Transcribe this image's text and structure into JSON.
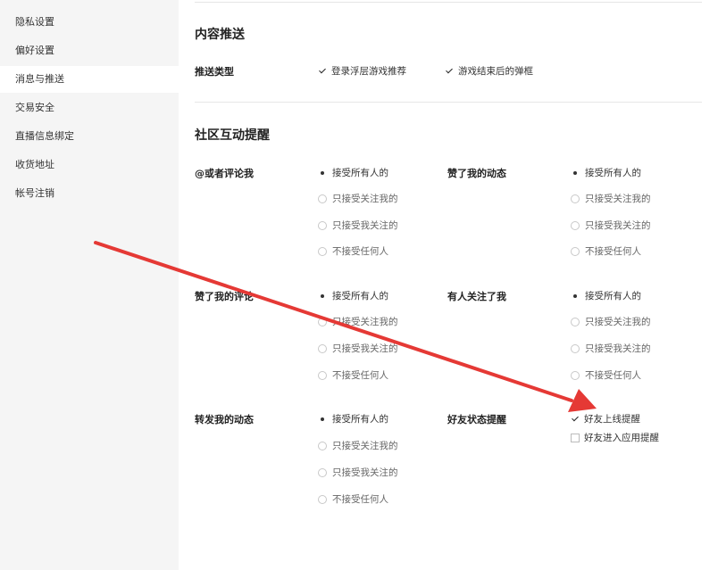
{
  "sidebar": {
    "items": [
      {
        "label": "隐私设置",
        "active": false
      },
      {
        "label": "偏好设置",
        "active": false
      },
      {
        "label": "消息与推送",
        "active": true
      },
      {
        "label": "交易安全",
        "active": false
      },
      {
        "label": "直播信息绑定",
        "active": false
      },
      {
        "label": "收货地址",
        "active": false
      },
      {
        "label": "帐号注销",
        "active": false
      }
    ]
  },
  "content_push": {
    "title": "内容推送",
    "type_label": "推送类型",
    "options": [
      {
        "label": "登录浮层游戏推荐",
        "checked": true
      },
      {
        "label": "游戏结束后的弹框",
        "checked": true
      }
    ]
  },
  "community": {
    "title": "社区互动提醒",
    "radio_options": [
      "接受所有人的",
      "只接受关注我的",
      "只接受我关注的",
      "不接受任何人"
    ],
    "groups": {
      "mention": {
        "label": "@或者评论我",
        "selected": 0
      },
      "like_post": {
        "label": "赞了我的动态",
        "selected": 0
      },
      "like_comment": {
        "label": "赞了我的评论",
        "selected": 0
      },
      "follow": {
        "label": "有人关注了我",
        "selected": 0
      },
      "repost": {
        "label": "转发我的动态",
        "selected": 0
      }
    },
    "friend_status": {
      "label": "好友状态提醒",
      "options": [
        {
          "label": "好友上线提醒",
          "checked": true
        },
        {
          "label": "好友进入应用提醒",
          "checked": false
        }
      ]
    }
  },
  "colors": {
    "arrow": "#e53935",
    "sidebar_bg": "#f5f5f5",
    "active_bg": "#ffffff"
  }
}
